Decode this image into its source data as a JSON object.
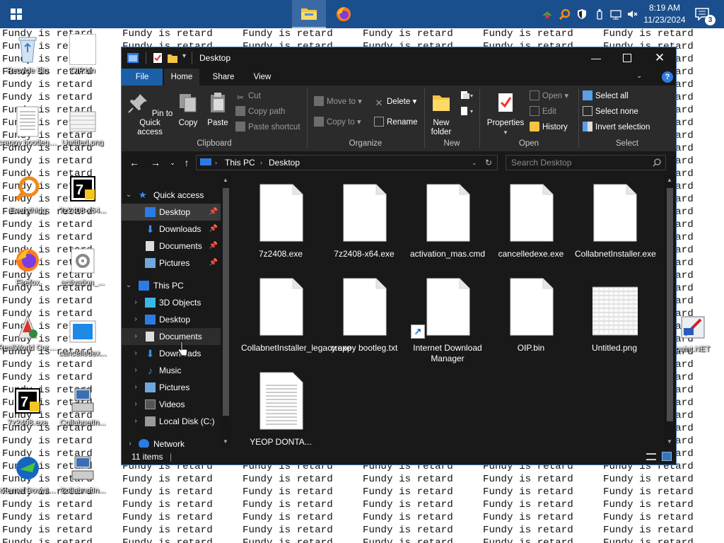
{
  "taskbar": {
    "clock_time": "8:19 AM",
    "clock_date": "11/23/2024",
    "notification_count": "3",
    "accent": "#1b4e8c"
  },
  "wallpaper": {
    "phrase": "Fundy is retard",
    "last_row_text": "Fundy is retard"
  },
  "desktop_icons": [
    {
      "label": "Recycle Bin"
    },
    {
      "label": "OIP.bin"
    },
    {
      "label": "crappy bootleg.txt"
    },
    {
      "label": "Untitled.png"
    },
    {
      "label": "Everything"
    },
    {
      "label": "7z2408-x64..."
    },
    {
      "label": "Firefox"
    },
    {
      "label": "activation_..."
    },
    {
      "label": "RealWorld Cursor Editor"
    },
    {
      "label": "cancelledex..."
    },
    {
      "label": "7z2408.exe"
    },
    {
      "label": "CollabnetIn..."
    },
    {
      "label": "Internet Downlo..."
    },
    {
      "label": "CollabnetIn..."
    },
    {
      "label": "paint.NET"
    }
  ],
  "window": {
    "title": "Desktop",
    "tabs": {
      "file": "File",
      "home": "Home",
      "share": "Share",
      "view": "View"
    },
    "ribbon": {
      "pin_to_quick_access": "Pin to Quick access",
      "copy": "Copy",
      "paste": "Paste",
      "cut": "Cut",
      "copy_path": "Copy path",
      "paste_shortcut": "Paste shortcut",
      "clipboard_group": "Clipboard",
      "move_to": "Move to",
      "copy_to": "Copy to",
      "delete": "Delete",
      "rename": "Rename",
      "organize_group": "Organize",
      "new_folder": "New folder",
      "new_group": "New",
      "properties": "Properties",
      "open": "Open",
      "edit": "Edit",
      "history": "History",
      "open_group": "Open",
      "select_all": "Select all",
      "select_none": "Select none",
      "invert_selection": "Invert selection",
      "select_group": "Select"
    },
    "address": {
      "segment1": "This PC",
      "segment2": "Desktop"
    },
    "search_placeholder": "Search Desktop",
    "nav": {
      "quick_access": "Quick access",
      "qa_desktop": "Desktop",
      "qa_downloads": "Downloads",
      "qa_documents": "Documents",
      "qa_pictures": "Pictures",
      "this_pc": "This PC",
      "objects_3d": "3D Objects",
      "desktop": "Desktop",
      "documents": "Documents",
      "downloads": "Downloads",
      "music": "Music",
      "pictures": "Pictures",
      "videos": "Videos",
      "local_disk": "Local Disk (C:)",
      "network": "Network"
    },
    "files": [
      {
        "name": "7z2408.exe",
        "kind": "file"
      },
      {
        "name": "7z2408-x64.exe",
        "kind": "file"
      },
      {
        "name": "activation_mas.cmd",
        "kind": "file"
      },
      {
        "name": "cancelledexe.exe",
        "kind": "file"
      },
      {
        "name": "CollabnetInstaller.exe",
        "kind": "file"
      },
      {
        "name": "CollabnetInstaller_legacy.exe",
        "kind": "file"
      },
      {
        "name": "crappy bootleg.txt",
        "kind": "file"
      },
      {
        "name": "Internet Download Manager",
        "kind": "shortcut"
      },
      {
        "name": "OIP.bin",
        "kind": "file"
      },
      {
        "name": "Untitled.png",
        "kind": "image"
      },
      {
        "name": "YEOP DONTA...",
        "kind": "text"
      }
    ],
    "status": {
      "item_count": "11 items"
    }
  }
}
